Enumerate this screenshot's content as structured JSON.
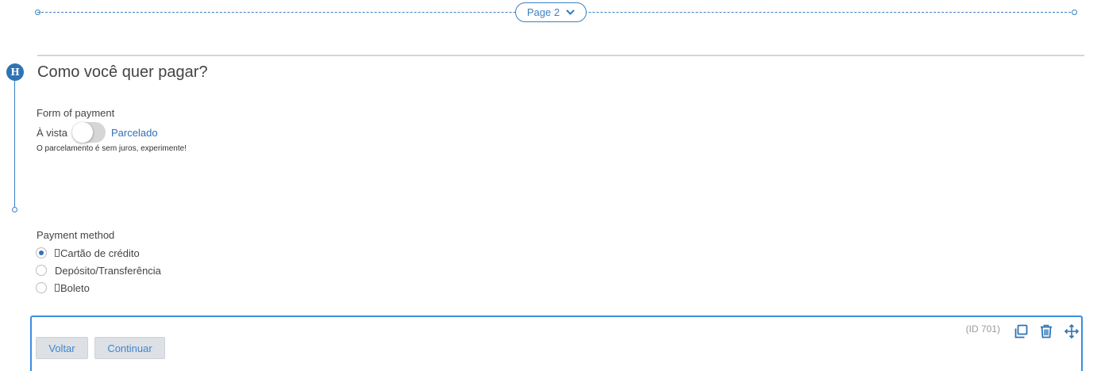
{
  "page_break": {
    "label": "Page 2",
    "icon": "chevron-down-icon"
  },
  "header": {
    "badge": "H",
    "title": "Como você quer pagar?"
  },
  "form_of_payment": {
    "label": "Form of payment",
    "toggle_off_label": "À vista",
    "toggle_on_label": "Parcelado",
    "toggle_state": "off",
    "help_text": "O parcelamento é sem juros, experimente!"
  },
  "payment_method": {
    "label": "Payment method",
    "options": [
      {
        "label": "Cartão de crédito",
        "selected": true,
        "has_glyph": true
      },
      {
        "label": "Depósito/Transferência",
        "selected": false,
        "has_glyph": false
      },
      {
        "label": "Boleto",
        "selected": false,
        "has_glyph": true
      }
    ]
  },
  "actions": {
    "item_id": "(ID 701)",
    "back_label": "Voltar",
    "next_label": "Continuar",
    "icons": [
      "copy-icon",
      "trash-icon",
      "move-icon"
    ]
  },
  "colors": {
    "accent": "#3b7fc4",
    "badge": "#2e74b5",
    "link": "#2e6fb8",
    "button_bg": "#dde0e4"
  }
}
